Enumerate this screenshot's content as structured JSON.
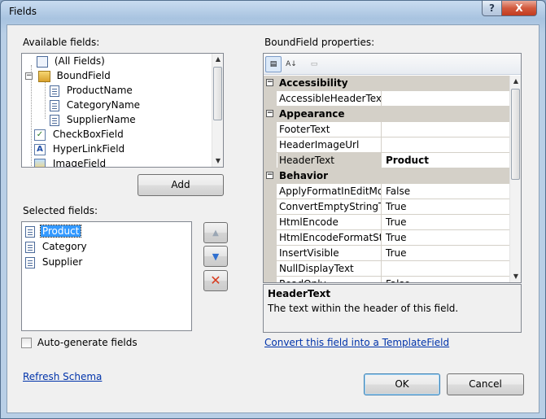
{
  "window": {
    "title": "Fields"
  },
  "titlebar": {
    "help_glyph": "?",
    "close_glyph": "X"
  },
  "available": {
    "label": "Available fields:",
    "items": [
      {
        "label": "(All Fields)",
        "icon": "all-fields-icon"
      },
      {
        "label": "BoundField",
        "icon": "boundfield-icon"
      },
      {
        "label": "ProductName",
        "icon": "field-icon"
      },
      {
        "label": "CategoryName",
        "icon": "field-icon"
      },
      {
        "label": "SupplierName",
        "icon": "field-icon"
      },
      {
        "label": "CheckBoxField",
        "icon": "checkboxfield-icon"
      },
      {
        "label": "HyperLinkField",
        "icon": "hyperlinkfield-icon"
      },
      {
        "label": "ImageField",
        "icon": "imagefield-icon"
      }
    ]
  },
  "add_button": "Add",
  "selected": {
    "label": "Selected fields:",
    "items": [
      {
        "label": "Product",
        "selected": true
      },
      {
        "label": "Category",
        "selected": false
      },
      {
        "label": "Supplier",
        "selected": false
      }
    ]
  },
  "auto_generate": {
    "label": "Auto-generate fields",
    "checked": false
  },
  "refresh_schema": "Refresh Schema",
  "properties": {
    "label": "BoundField properties:",
    "categories": [
      {
        "name": "Accessibility",
        "rows": [
          {
            "name": "AccessibleHeaderText",
            "value": ""
          }
        ]
      },
      {
        "name": "Appearance",
        "rows": [
          {
            "name": "FooterText",
            "value": ""
          },
          {
            "name": "HeaderImageUrl",
            "value": ""
          },
          {
            "name": "HeaderText",
            "value": "Product"
          }
        ]
      },
      {
        "name": "Behavior",
        "rows": [
          {
            "name": "ApplyFormatInEditMode",
            "value": "False"
          },
          {
            "name": "ConvertEmptyStringToNull",
            "value": "True"
          },
          {
            "name": "HtmlEncode",
            "value": "True"
          },
          {
            "name": "HtmlEncodeFormatString",
            "value": "True"
          },
          {
            "name": "InsertVisible",
            "value": "True"
          },
          {
            "name": "NullDisplayText",
            "value": ""
          },
          {
            "name": "ReadOnly",
            "value": "False"
          }
        ]
      }
    ],
    "description_title": "HeaderText",
    "description_text": "The text within the header of this field."
  },
  "convert_link": "Convert this field into a TemplateField",
  "ok_button": "OK",
  "cancel_button": "Cancel",
  "colors": {
    "selection": "#3399ff",
    "link": "#0033aa",
    "delete": "#d83a1e",
    "arrow": "#2f6fcf"
  }
}
